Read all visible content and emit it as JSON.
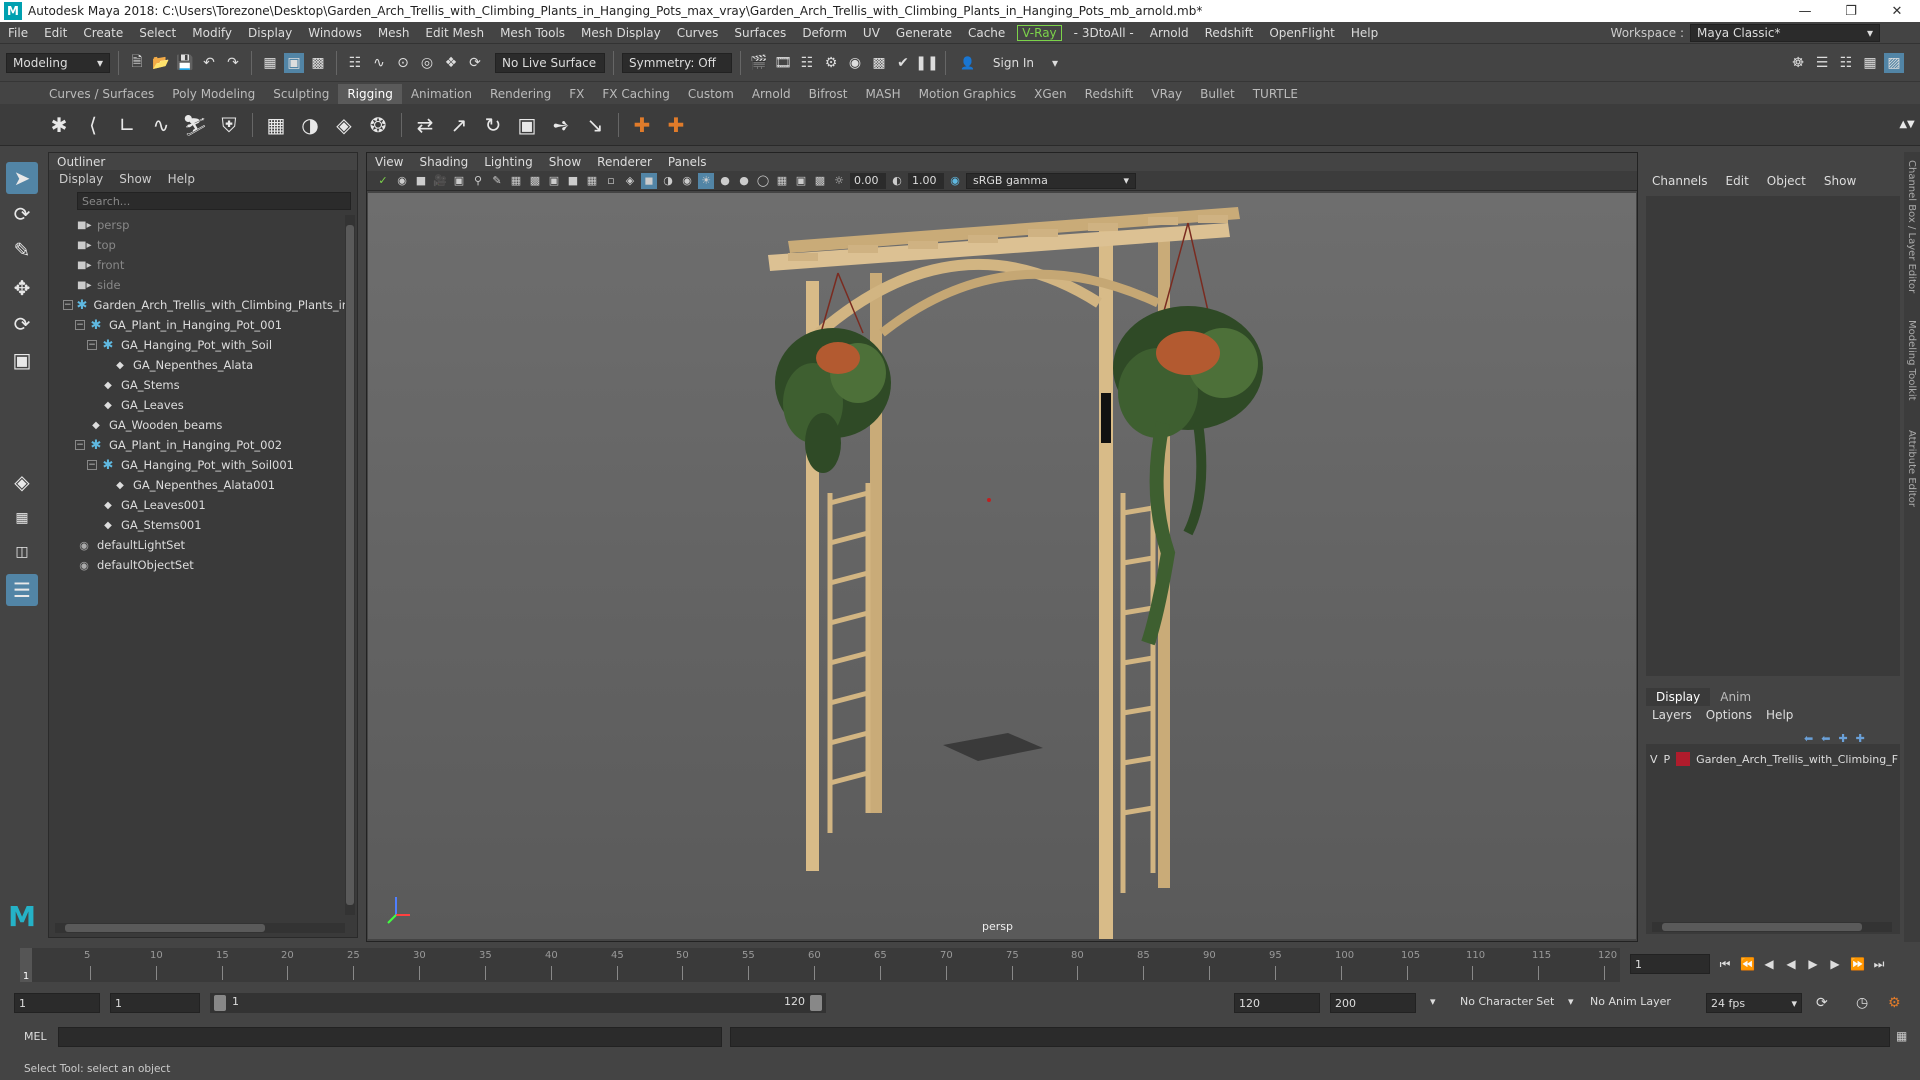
{
  "window": {
    "title": "Autodesk Maya 2018: C:\\Users\\Torezone\\Desktop\\Garden_Arch_Trellis_with_Climbing_Plants_in_Hanging_Pots_max_vray\\Garden_Arch_Trellis_with_Climbing_Plants_in_Hanging_Pots_mb_arnold.mb*",
    "logo": "M"
  },
  "menu": [
    "File",
    "Edit",
    "Create",
    "Select",
    "Modify",
    "Display",
    "Windows",
    "Mesh",
    "Edit Mesh",
    "Mesh Tools",
    "Mesh Display",
    "Curves",
    "Surfaces",
    "Deform",
    "UV",
    "Generate",
    "Cache"
  ],
  "menu_vray": "V-Ray",
  "menu_more": [
    "- 3DtoAll -",
    "Arnold",
    "Redshift",
    "OpenFlight",
    "Help"
  ],
  "workspace": {
    "label": "Workspace :",
    "value": "Maya Classic*"
  },
  "status": {
    "mode": "Modeling",
    "live_surface": "No Live Surface",
    "symmetry": "Symmetry: Off",
    "sign_in": "Sign In"
  },
  "shelf_tabs": [
    "Curves / Surfaces",
    "Poly Modeling",
    "Sculpting",
    "Rigging",
    "Animation",
    "Rendering",
    "FX",
    "FX Caching",
    "Custom",
    "Arnold",
    "Bifrost",
    "MASH",
    "Motion Graphics",
    "XGen",
    "Redshift",
    "VRay",
    "Bullet",
    "TURTLE"
  ],
  "shelf_active": "Rigging",
  "outliner": {
    "title": "Outliner",
    "menu": [
      "Display",
      "Show",
      "Help"
    ],
    "search_placeholder": "Search...",
    "items": [
      {
        "label": "persp",
        "indent": 0,
        "icon": "cam",
        "dim": true,
        "exp": ""
      },
      {
        "label": "top",
        "indent": 0,
        "icon": "cam",
        "dim": true,
        "exp": ""
      },
      {
        "label": "front",
        "indent": 0,
        "icon": "cam",
        "dim": true,
        "exp": ""
      },
      {
        "label": "side",
        "indent": 0,
        "icon": "cam",
        "dim": true,
        "exp": ""
      },
      {
        "label": "Garden_Arch_Trellis_with_Climbing_Plants_in_H",
        "indent": 0,
        "icon": "grp",
        "exp": "−"
      },
      {
        "label": "GA_Plant_in_Hanging_Pot_001",
        "indent": 1,
        "icon": "grp",
        "exp": "−"
      },
      {
        "label": "GA_Hanging_Pot_with_Soil",
        "indent": 2,
        "icon": "grp",
        "exp": "−"
      },
      {
        "label": "GA_Nepenthes_Alata",
        "indent": 3,
        "icon": "mesh",
        "exp": ""
      },
      {
        "label": "GA_Stems",
        "indent": 2,
        "icon": "mesh",
        "exp": ""
      },
      {
        "label": "GA_Leaves",
        "indent": 2,
        "icon": "mesh",
        "exp": ""
      },
      {
        "label": "GA_Wooden_beams",
        "indent": 1,
        "icon": "mesh",
        "exp": ""
      },
      {
        "label": "GA_Plant_in_Hanging_Pot_002",
        "indent": 1,
        "icon": "grp",
        "exp": "−"
      },
      {
        "label": "GA_Hanging_Pot_with_Soil001",
        "indent": 2,
        "icon": "grp",
        "exp": "−"
      },
      {
        "label": "GA_Nepenthes_Alata001",
        "indent": 3,
        "icon": "mesh",
        "exp": ""
      },
      {
        "label": "GA_Leaves001",
        "indent": 2,
        "icon": "mesh",
        "exp": ""
      },
      {
        "label": "GA_Stems001",
        "indent": 2,
        "icon": "mesh",
        "exp": ""
      },
      {
        "label": "defaultLightSet",
        "indent": 0,
        "icon": "set",
        "exp": ""
      },
      {
        "label": "defaultObjectSet",
        "indent": 0,
        "icon": "set",
        "exp": ""
      }
    ]
  },
  "viewport": {
    "menu": [
      "View",
      "Shading",
      "Lighting",
      "Show",
      "Renderer",
      "Panels"
    ],
    "exposure": "0.00",
    "gamma": "1.00",
    "color_space": "sRGB gamma",
    "camera": "persp"
  },
  "channelbox": {
    "menu": [
      "Channels",
      "Edit",
      "Object",
      "Show"
    ],
    "side_tabs": [
      "Channel Box / Layer Editor",
      "Modeling Toolkit",
      "Attribute Editor"
    ]
  },
  "layers": {
    "tabs": [
      "Display",
      "Anim"
    ],
    "menu": [
      "Layers",
      "Options",
      "Help"
    ],
    "row": {
      "v": "V",
      "p": "P",
      "name": "Garden_Arch_Trellis_with_Climbing_F",
      "color": "#b01c2c"
    }
  },
  "timeline": {
    "ticks": [
      "5",
      "10",
      "15",
      "20",
      "25",
      "30",
      "35",
      "40",
      "45",
      "50",
      "55",
      "60",
      "65",
      "70",
      "75",
      "80",
      "85",
      "90",
      "95",
      "100",
      "105",
      "110",
      "115",
      "120"
    ],
    "current_frame": "1",
    "frame_field": "1"
  },
  "range": {
    "start": "1",
    "playback_start": "1",
    "slider_start": "1",
    "slider_end": "120",
    "playback_end": "120",
    "end": "200",
    "character_set": "No Character Set",
    "anim_layer": "No Anim Layer",
    "fps": "24 fps"
  },
  "cmd": {
    "label": "MEL"
  },
  "help_line": "Select Tool: select an object"
}
